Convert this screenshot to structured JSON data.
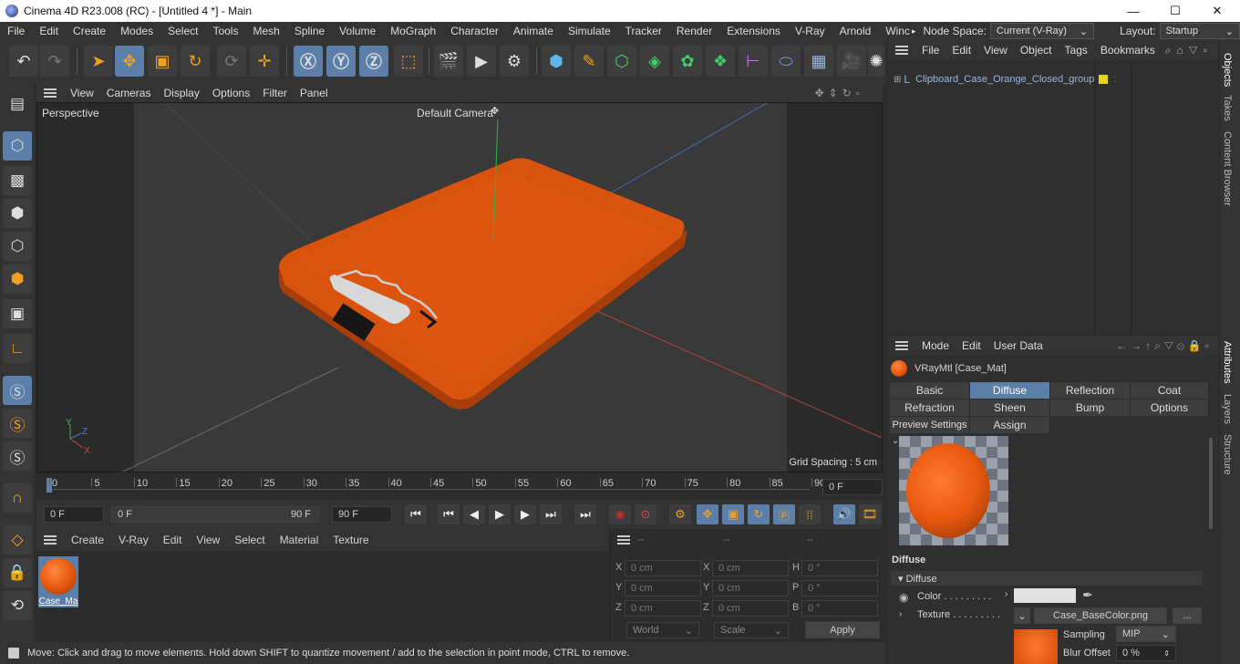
{
  "window": {
    "title": "Cinema 4D R23.008 (RC) - [Untitled 4 *] - Main",
    "min": "—",
    "max": "☐",
    "close": "✕"
  },
  "menubar": {
    "items": [
      "File",
      "Edit",
      "Create",
      "Modes",
      "Select",
      "Tools",
      "Mesh",
      "Spline",
      "Volume",
      "MoGraph",
      "Character",
      "Animate",
      "Simulate",
      "Tracker",
      "Render",
      "Extensions",
      "V-Ray",
      "Arnold",
      "Winc"
    ],
    "overflow": "▸",
    "node_space_label": "Node Space:",
    "node_space_value": "Current (V-Ray)",
    "layout_label": "Layout:",
    "layout_value": "Startup"
  },
  "viewport": {
    "menu": [
      "View",
      "Cameras",
      "Display",
      "Options",
      "Filter",
      "Panel"
    ],
    "label": "Perspective",
    "camera": "Default Camera",
    "camera_icon": "✥",
    "grid_spacing": "Grid Spacing : 5 cm",
    "axis": {
      "y": "Y",
      "z": "Z",
      "x": "X"
    }
  },
  "timeline": {
    "ticks": [
      "0",
      "5",
      "10",
      "15",
      "20",
      "25",
      "30",
      "35",
      "40",
      "45",
      "50",
      "55",
      "60",
      "65",
      "70",
      "75",
      "80",
      "85",
      "90"
    ],
    "current_frame": "0 F"
  },
  "transport": {
    "start": "0 F",
    "range_start": "0 F",
    "range_end": "90 F",
    "end": "90 F"
  },
  "material_manager": {
    "menu": [
      "Create",
      "V-Ray",
      "Edit",
      "View",
      "Select",
      "Material",
      "Texture"
    ],
    "material_name": "Case_Ma"
  },
  "coordinates": {
    "headers": [
      "--",
      "--",
      "--"
    ],
    "rows": [
      {
        "a": "X",
        "av": "0 cm",
        "b": "X",
        "bv": "0 cm",
        "c": "H",
        "cv": "0 °"
      },
      {
        "a": "Y",
        "av": "0 cm",
        "b": "Y",
        "bv": "0 cm",
        "c": "P",
        "cv": "0 °"
      },
      {
        "a": "Z",
        "av": "0 cm",
        "b": "Z",
        "bv": "0 cm",
        "c": "B",
        "cv": "0 °"
      }
    ],
    "space": "World",
    "scale": "Scale",
    "apply": "Apply"
  },
  "status": "Move: Click and drag to move elements. Hold down SHIFT to quantize movement / add to the selection in point mode, CTRL to remove.",
  "objects": {
    "menu": [
      "File",
      "Edit",
      "View",
      "Object",
      "Tags",
      "Bookmarks"
    ],
    "item": "Clipboard_Case_Orange_Closed_group"
  },
  "attributes": {
    "menu": [
      "Mode",
      "Edit",
      "User Data"
    ],
    "material": "VRayMtl [Case_Mat]",
    "tabs_row1": [
      "Basic",
      "Diffuse",
      "Reflection",
      "Coat"
    ],
    "tabs_row2": [
      "Refraction",
      "Sheen",
      "Bump",
      "Options"
    ],
    "tabs_row3": [
      "Preview Settings",
      "Assign"
    ],
    "section": "Diffuse",
    "subsection": "▾ Diffuse",
    "color_label": "Color . . . . . . . . .",
    "texture_label": "Texture . . . . . . . . .",
    "texture_file": "Case_BaseColor.png",
    "more": "...",
    "sampling_label": "Sampling",
    "sampling_value": "MIP",
    "blur_label": "Blur Offset",
    "blur_value": "0 %"
  },
  "side_tabs": [
    "Objects",
    "Takes",
    "Content Browser",
    "Attributes",
    "Layers",
    "Structure"
  ],
  "colors": {
    "accent": "#5b7fa8",
    "orange": "#e8590f",
    "tag_yellow": "#e6d619"
  }
}
